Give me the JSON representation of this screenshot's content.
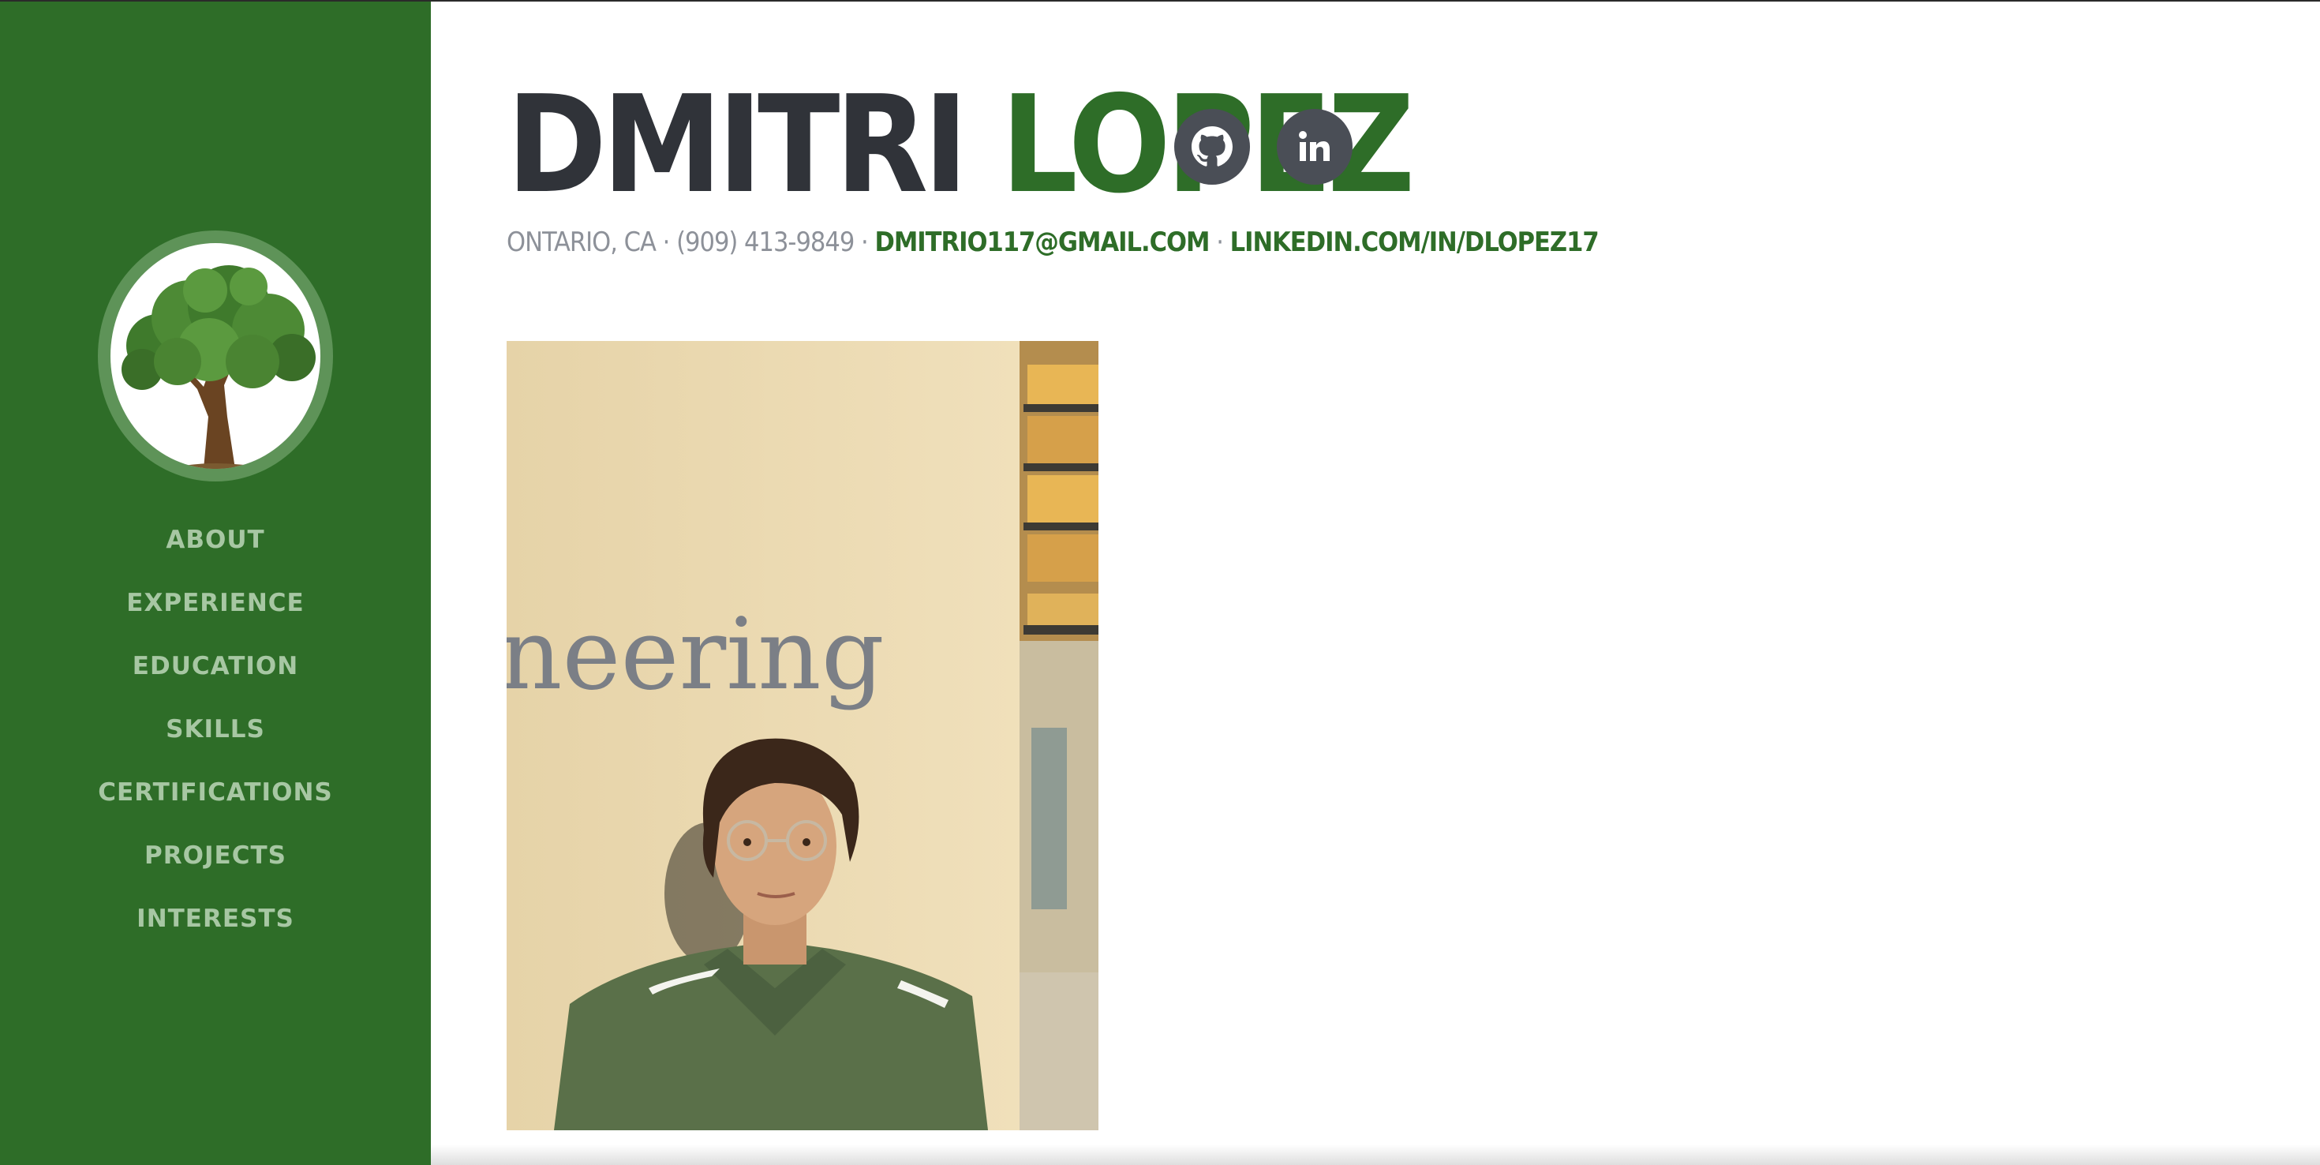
{
  "profile": {
    "first_name": "DMITRI",
    "last_name": "LOPEZ",
    "location": "ONTARIO, CA",
    "phone": "(909) 413-9849",
    "email": "DMITRIO117@GMAIL.COM",
    "linkedin": "LINKEDIN.COM/IN/DLOPEZ17",
    "separator": " · "
  },
  "nav": {
    "items": [
      {
        "label": "ABOUT"
      },
      {
        "label": "EXPERIENCE"
      },
      {
        "label": "EDUCATION"
      },
      {
        "label": "SKILLS"
      },
      {
        "label": "CERTIFICATIONS"
      },
      {
        "label": "PROJECTS"
      },
      {
        "label": "INTERESTS"
      }
    ]
  },
  "photo": {
    "sign_text": "neering"
  },
  "social": {
    "github_icon": "github-icon",
    "linkedin_icon": "linkedin-icon",
    "linkedin_text": "in"
  },
  "colors": {
    "sidebar": "#2e6d28",
    "accent": "#2e6d28",
    "name_dark": "#303339",
    "nav_text": "#a7c7a3",
    "muted": "#8d9199",
    "icon_bg": "#4a4e56"
  }
}
